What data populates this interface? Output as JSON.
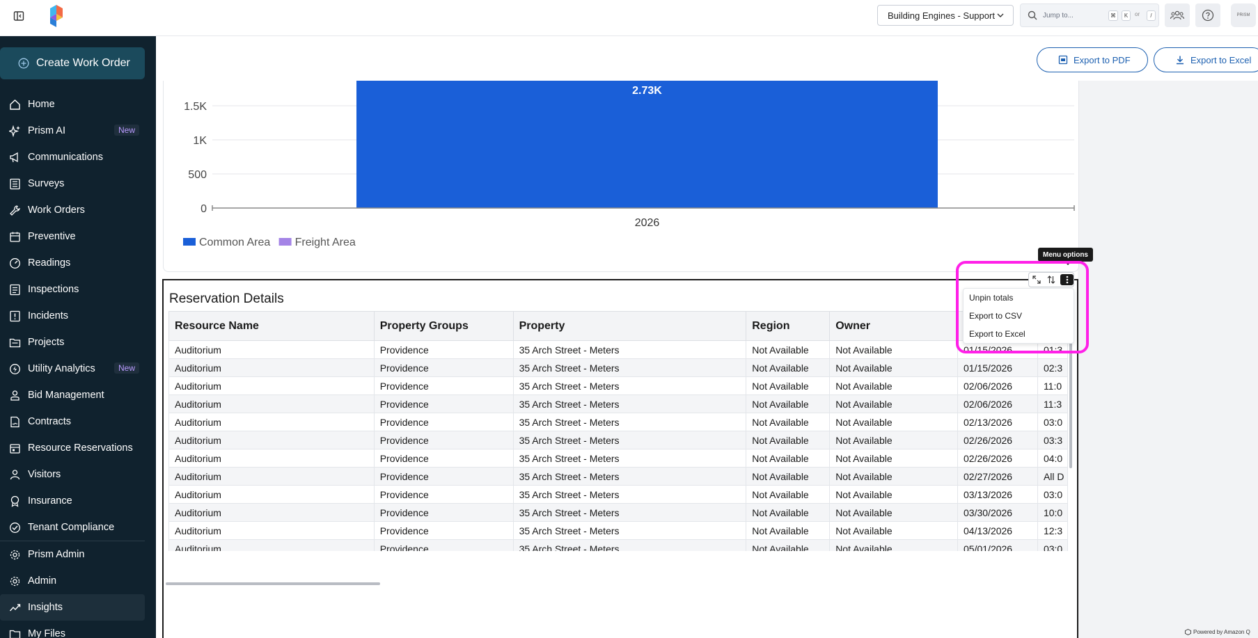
{
  "header": {
    "org_select": "Building Engines - Support",
    "jump_placeholder": "Jump to...",
    "kbd_keys": [
      "⌘",
      "K",
      "/"
    ],
    "kbd_or": "or",
    "avatar_text": "PRISM"
  },
  "sidebar": {
    "create_label": "Create Work Order",
    "items": [
      {
        "label": "Home",
        "icon": "home-icon"
      },
      {
        "label": "Prism AI",
        "icon": "sparkle-icon",
        "badge": "New"
      },
      {
        "label": "Communications",
        "icon": "megaphone-icon"
      },
      {
        "label": "Surveys",
        "icon": "survey-icon"
      },
      {
        "label": "Work Orders",
        "icon": "wrench-icon"
      },
      {
        "label": "Preventive",
        "icon": "calendar-icon"
      },
      {
        "label": "Readings",
        "icon": "gauge-icon"
      },
      {
        "label": "Inspections",
        "icon": "checklist-icon"
      },
      {
        "label": "Incidents",
        "icon": "alert-icon"
      },
      {
        "label": "Projects",
        "icon": "folder-icon"
      },
      {
        "label": "Utility Analytics",
        "icon": "utility-icon",
        "badge": "New"
      },
      {
        "label": "Bid Management",
        "icon": "bid-icon"
      },
      {
        "label": "Contracts",
        "icon": "contract-icon"
      },
      {
        "label": "Resource Reservations",
        "icon": "reservation-icon"
      },
      {
        "label": "Visitors",
        "icon": "visitor-icon"
      },
      {
        "label": "Insurance",
        "icon": "insurance-icon"
      },
      {
        "label": "Tenant Compliance",
        "icon": "compliance-icon"
      },
      {
        "label": "Prism Admin",
        "icon": "gear-icon"
      },
      {
        "label": "Admin",
        "icon": "gear-icon"
      },
      {
        "label": "Insights",
        "icon": "insights-icon"
      },
      {
        "label": "My Files",
        "icon": "files-icon"
      }
    ]
  },
  "toolbar": {
    "export_pdf": "Export to PDF",
    "export_excel": "Export to Excel"
  },
  "chart_data": {
    "type": "bar",
    "categories": [
      "2026"
    ],
    "series": [
      {
        "name": "Common Area",
        "values": [
          2730
        ],
        "color": "#1a5fd8"
      },
      {
        "name": "Freight Area",
        "values": [
          0
        ],
        "color": "#a484e6"
      }
    ],
    "data_labels": [
      "2.73K"
    ],
    "yticks": [
      "0",
      "500",
      "1K",
      "1.5K"
    ],
    "ylim": [
      0,
      1500
    ],
    "legend_position": "bottom-left"
  },
  "table": {
    "title": "Reservation Details",
    "columns": [
      "Resource Name",
      "Property Groups",
      "Property",
      "Region",
      "Owner",
      "",
      ""
    ],
    "rows": [
      [
        "Auditorium",
        "Providence",
        "35 Arch Street - Meters",
        "Not Available",
        "Not Available",
        "01/15/2026",
        "01:3"
      ],
      [
        "Auditorium",
        "Providence",
        "35 Arch Street - Meters",
        "Not Available",
        "Not Available",
        "01/15/2026",
        "02:3"
      ],
      [
        "Auditorium",
        "Providence",
        "35 Arch Street - Meters",
        "Not Available",
        "Not Available",
        "02/06/2026",
        "11:0"
      ],
      [
        "Auditorium",
        "Providence",
        "35 Arch Street - Meters",
        "Not Available",
        "Not Available",
        "02/06/2026",
        "11:3"
      ],
      [
        "Auditorium",
        "Providence",
        "35 Arch Street - Meters",
        "Not Available",
        "Not Available",
        "02/13/2026",
        "03:0"
      ],
      [
        "Auditorium",
        "Providence",
        "35 Arch Street - Meters",
        "Not Available",
        "Not Available",
        "02/26/2026",
        "03:3"
      ],
      [
        "Auditorium",
        "Providence",
        "35 Arch Street - Meters",
        "Not Available",
        "Not Available",
        "02/26/2026",
        "04:0"
      ],
      [
        "Auditorium",
        "Providence",
        "35 Arch Street - Meters",
        "Not Available",
        "Not Available",
        "02/27/2026",
        "All D"
      ],
      [
        "Auditorium",
        "Providence",
        "35 Arch Street - Meters",
        "Not Available",
        "Not Available",
        "03/13/2026",
        "03:0"
      ],
      [
        "Auditorium",
        "Providence",
        "35 Arch Street - Meters",
        "Not Available",
        "Not Available",
        "03/30/2026",
        "10:0"
      ],
      [
        "Auditorium",
        "Providence",
        "35 Arch Street - Meters",
        "Not Available",
        "Not Available",
        "04/13/2026",
        "12:3"
      ],
      [
        "Auditorium",
        "Providence",
        "35 Arch Street - Meters",
        "Not Available",
        "Not Available",
        "05/01/2026",
        "03:0"
      ]
    ]
  },
  "menu": {
    "tooltip": "Menu options",
    "items": [
      "Unpin totals",
      "Export to CSV",
      "Export to Excel"
    ]
  },
  "footer": {
    "powered": "Powered by Amazon Q"
  },
  "colors": {
    "sidebar_bg": "#10222e",
    "accent": "#1b5fb0",
    "bar": "#1a5fd8",
    "highlight": "#ff20e8",
    "badge": "#b99bff"
  }
}
